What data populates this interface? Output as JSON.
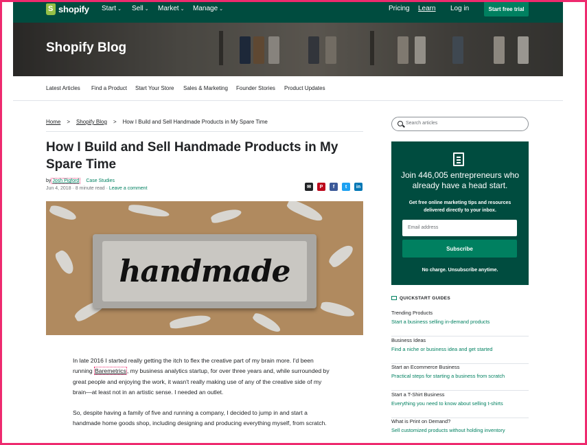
{
  "topnav": {
    "brand": "shopify",
    "items": [
      {
        "label": "Start",
        "chevron": "⌄"
      },
      {
        "label": "Sell",
        "chevron": "⌄"
      },
      {
        "label": "Market",
        "chevron": "⌄"
      },
      {
        "label": "Manage",
        "chevron": "⌄"
      }
    ],
    "pricing": "Pricing",
    "learn": "Learn",
    "login": "Log in",
    "cta": "Start free trial"
  },
  "hero": {
    "title": "Shopify Blog"
  },
  "categories": [
    "Latest Articles",
    "Find a Product",
    "Start Your Store",
    "Sales & Marketing",
    "Founder Stories",
    "Product Updates"
  ],
  "breadcrumb": {
    "home": "Home",
    "blog": "Shopify Blog",
    "current": "How I Build and Sell Handmade Products in My Spare Time",
    "sep": ">"
  },
  "article": {
    "title": "How I Build and Sell Handmade Products in My Spare Time",
    "by": "by",
    "author": "Josh Pigford",
    "category": "Case Studies",
    "date": "Jun 4, 2018",
    "read_time": "8 minute read",
    "comment_link": "Leave a comment",
    "image_word": "handmade",
    "share_icons": [
      {
        "name": "email-share-icon",
        "glyph": "✉",
        "color": "#212326"
      },
      {
        "name": "pinterest-share-icon",
        "glyph": "P",
        "color": "#bd081c"
      },
      {
        "name": "facebook-share-icon",
        "glyph": "f",
        "color": "#3b5998"
      },
      {
        "name": "twitter-share-icon",
        "glyph": "t",
        "color": "#1da1f2"
      },
      {
        "name": "linkedin-share-icon",
        "glyph": "in",
        "color": "#0077b5"
      }
    ],
    "p1_a": "In late 2016 I started really getting the itch to flex the creative part of my brain more. I'd been running ",
    "p1_link": "Baremetrics",
    "p1_b": ", my business analytics startup, for over three years and, while surrounded by great people and enjoying the work, it wasn't really making use of any of the creative side of my brain—at least not in an artistic sense. I needed an outlet.",
    "p2": "So, despite having a family of five and running a company, I decided to jump in and start a handmade home goods shop, including designing and producing everything myself, from scratch."
  },
  "sidebar": {
    "search_placeholder": "Search articles",
    "promo": {
      "headline": "Join 446,005 entrepreneurs who already have a head start.",
      "body": "Get free online marketing tips and resources delivered directly to your inbox.",
      "email_placeholder": "Email address",
      "button": "Subscribe",
      "note": "No charge. Unsubscribe anytime."
    },
    "quickstart_title": "QUICKSTART GUIDES",
    "guides": [
      {
        "title": "Trending Products",
        "subtitle": "Start a business selling in-demand products"
      },
      {
        "title": "Business Ideas",
        "subtitle": "Find a niche or business idea and get started"
      },
      {
        "title": "Start an Ecommerce Business",
        "subtitle": "Practical steps for starting a business from scratch"
      },
      {
        "title": "Start a T-Shirt Business",
        "subtitle": "Everything you need to know about selling t-shirts"
      },
      {
        "title": "What is Print on Demand?",
        "subtitle": "Sell customized products without holding inventory"
      }
    ]
  },
  "colors": {
    "brand_dark": "#004c3f",
    "brand_green": "#008060",
    "highlight": "#ee2a6e"
  }
}
